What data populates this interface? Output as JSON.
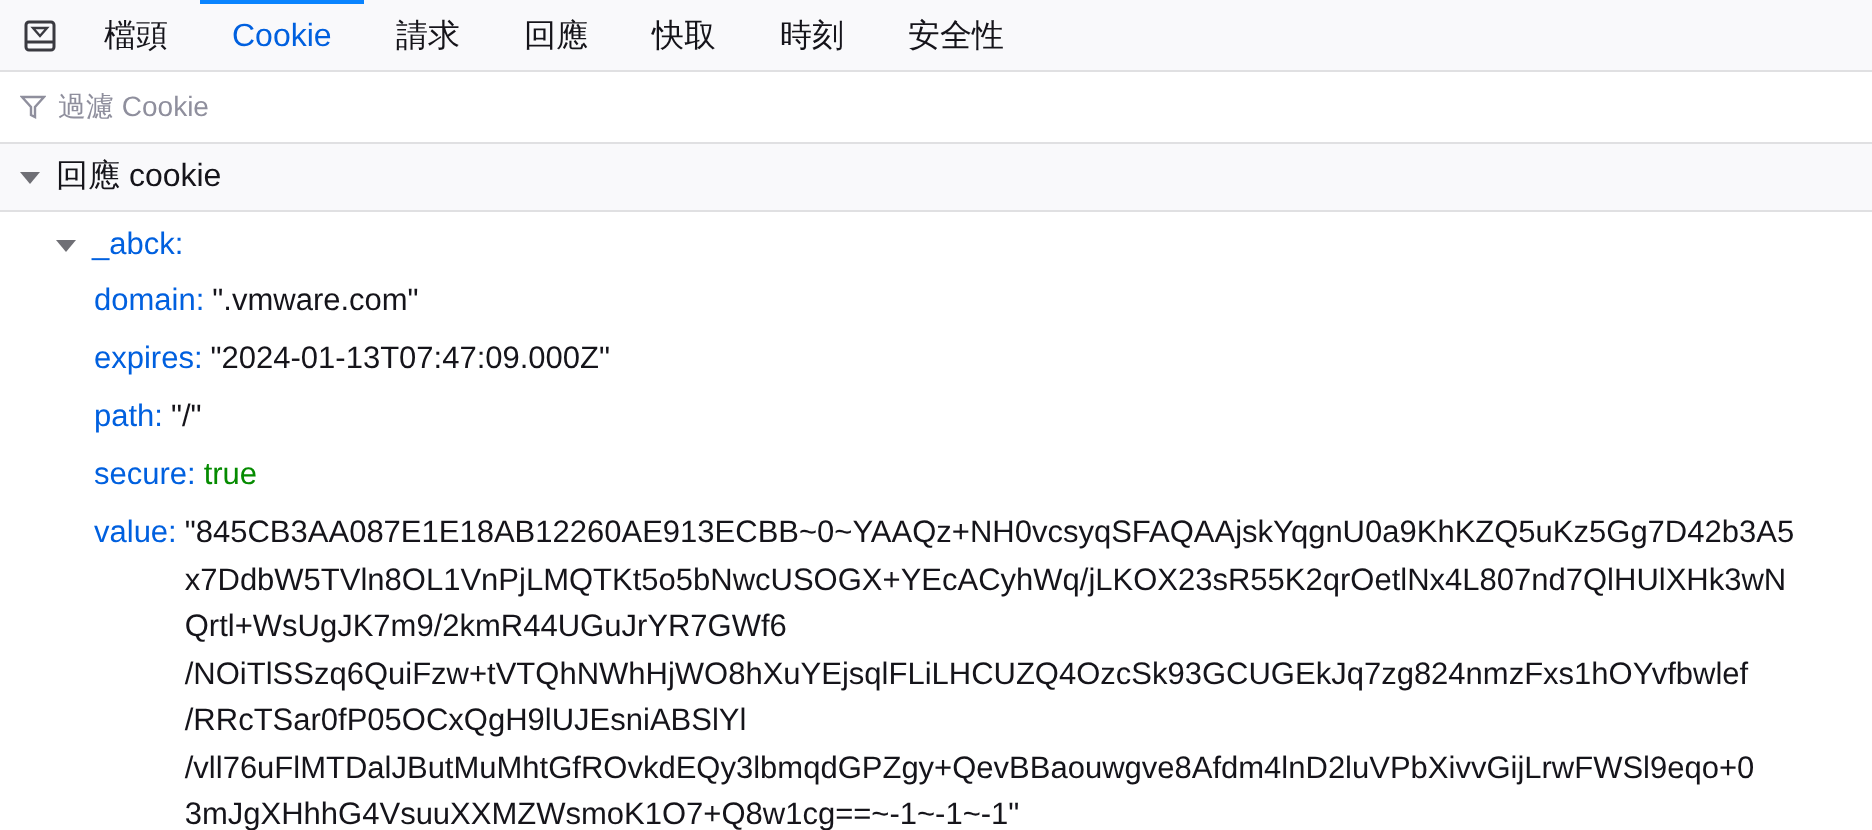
{
  "tabs": [
    {
      "label": "檔頭",
      "selected": false
    },
    {
      "label": "Cookie",
      "selected": true
    },
    {
      "label": "請求",
      "selected": false
    },
    {
      "label": "回應",
      "selected": false
    },
    {
      "label": "快取",
      "selected": false
    },
    {
      "label": "時刻",
      "selected": false
    },
    {
      "label": "安全性",
      "selected": false
    }
  ],
  "filter": {
    "placeholder": "過濾 Cookie"
  },
  "section": {
    "title": "回應 cookie",
    "expanded": true,
    "cookies": [
      {
        "name": "_abck:",
        "expanded": true,
        "fields": [
          {
            "key": "domain:",
            "kind": "string",
            "value": [
              "\".vmware.com\""
            ]
          },
          {
            "key": "expires:",
            "kind": "string",
            "value": [
              "\"2024-01-13T07:47:09.000Z\""
            ]
          },
          {
            "key": "path:",
            "kind": "string",
            "value": [
              "\"/\""
            ]
          },
          {
            "key": "secure:",
            "kind": "boolean",
            "value": [
              "true"
            ]
          },
          {
            "key": "value:",
            "kind": "string",
            "value": [
              "\"845CB3AA087E1E18AB12260AE913ECBB~0~YAAQz+NH0vcsyqSFAQAAjskYqgnU0a9KhKZQ5uKz5Gg7D42b3A5",
              "x7DdbW5TVln8OL1VnPjLMQTKt5o5bNwcUSOGX+YEcACyhWq/jLKOX23sR55K2qrOetlNx4L807nd7QlHUlXHk3wN",
              "Qrtl+WsUgJK7m9/2kmR44UGuJrYR7GWf6",
              "/NOiTlSSzq6QuiFzw+tVTQhNWhHjWO8hXuYEjsqlFLiLHCUZQ4OzcSk93GCUGEkJq7zg824nmzFxs1hOYvfbwlef",
              "/RRcTSar0fP05OCxQgH9lUJEsniABSlYl",
              "/vll76uFlMTDalJButMuMhtGfROvkdEQy3lbmqdGPZgy+QevBBaouwgve8Afdm4lnD2luVPbXivvGijLrwFWSl9eqo+0",
              "3mJgXHhhG4VsuuXXMZWsmoK1O7+Q8w1cg==~-1~-1~-1\""
            ]
          }
        ]
      }
    ]
  }
}
